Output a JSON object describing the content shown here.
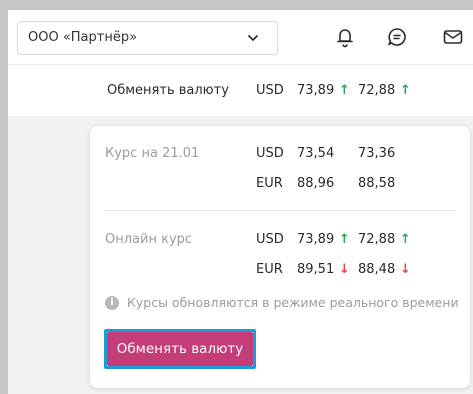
{
  "header": {
    "company": "ООО «Партнёр»",
    "icons": [
      "chevron-down-icon",
      "bell-icon",
      "chat-icon",
      "mail-icon"
    ]
  },
  "quick": {
    "label": "Обменять валюту",
    "currency": "USD",
    "buy": "73,89",
    "sell": "72,88",
    "arrow_up": "↑"
  },
  "card": {
    "fixed": {
      "label": "Курс на 21.01",
      "rows": [
        {
          "currency": "USD",
          "buy": "73,54",
          "sell": "73,36"
        },
        {
          "currency": "EUR",
          "buy": "88,96",
          "sell": "88,58"
        }
      ]
    },
    "online": {
      "label": "Онлайн курс",
      "rows": [
        {
          "currency": "USD",
          "buy": "73,89",
          "buy_dir": "↑",
          "sell": "72,88",
          "sell_dir": "↑"
        },
        {
          "currency": "EUR",
          "buy": "89,51",
          "buy_dir": "↓",
          "sell": "88,48",
          "sell_dir": "↓"
        }
      ]
    },
    "info_icon": "i",
    "info": "Курсы обновляются в режиме реального времени",
    "button": "Обменять валюту"
  },
  "colors": {
    "accent": "#c43c78",
    "focus": "#1e9ad6",
    "up": "#27a661",
    "down": "#e0474c"
  }
}
